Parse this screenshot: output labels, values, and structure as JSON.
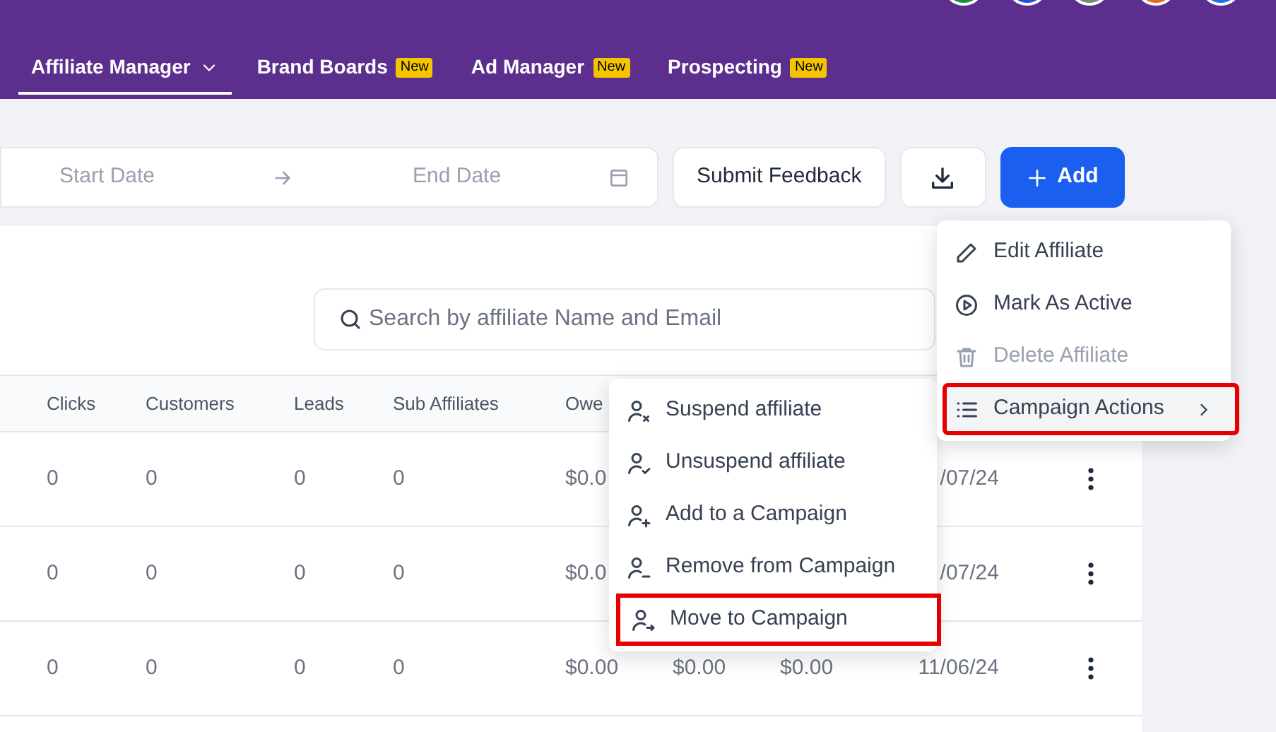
{
  "nav": [
    {
      "label": "Affiliate Manager",
      "selected": true,
      "dropdown": true
    },
    {
      "label": "Brand Boards",
      "selected": false,
      "badge": "New"
    },
    {
      "label": "Ad Manager",
      "selected": false,
      "badge": "New"
    },
    {
      "label": "Prospecting",
      "selected": false,
      "badge": "New"
    }
  ],
  "toolbar": {
    "start_placeholder": "Start Date",
    "end_placeholder": "End Date",
    "feedback_button": "Submit Feedback",
    "add_button": "Add"
  },
  "search": {
    "placeholder": "Search by affiliate Name and Email"
  },
  "table": {
    "columns": [
      "Clicks",
      "Customers",
      "Leads",
      "Sub Affiliates",
      "Owe"
    ],
    "rows": [
      {
        "cells": [
          "0",
          "0",
          "0",
          "0",
          "$0.0"
        ],
        "date": "/07/24"
      },
      {
        "cells": [
          "0",
          "0",
          "0",
          "0",
          "$0.0"
        ],
        "date": "/07/24"
      },
      {
        "cells": [
          "0",
          "0",
          "0",
          "0",
          "$0.00",
          "$0.00",
          "$0.00"
        ],
        "date": "11/06/24"
      }
    ]
  },
  "menu": {
    "items": [
      {
        "label": "Edit Affiliate",
        "disabled": false,
        "highlighted": false,
        "submenu": false
      },
      {
        "label": "Mark As Active",
        "disabled": false,
        "highlighted": false,
        "submenu": false
      },
      {
        "label": "Delete Affiliate",
        "disabled": true,
        "highlighted": false,
        "submenu": false
      },
      {
        "label": "Campaign Actions",
        "disabled": false,
        "highlighted": true,
        "submenu": true
      }
    ]
  },
  "submenu": {
    "items": [
      {
        "label": "Suspend affiliate",
        "highlighted": false
      },
      {
        "label": "Unsuspend affiliate",
        "highlighted": false
      },
      {
        "label": "Add to a Campaign",
        "highlighted": false
      },
      {
        "label": "Remove from Campaign",
        "highlighted": false
      },
      {
        "label": "Move to Campaign",
        "highlighted": true
      }
    ]
  }
}
